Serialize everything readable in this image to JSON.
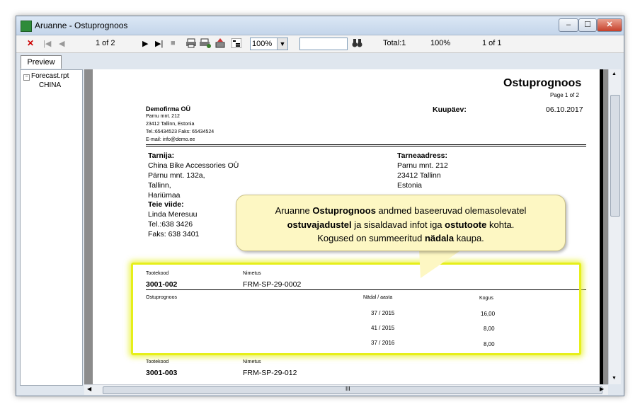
{
  "window": {
    "title": "Aruanne - Ostuprognoos",
    "minimize": "‒",
    "maximize": "☐",
    "close": "✕"
  },
  "toolbar": {
    "close_icon": "✕",
    "first_icon": "|◀",
    "prev_icon": "◀",
    "page_of": "1 of 2",
    "next_icon": "▶",
    "last_icon": "▶|",
    "stop_icon": "■",
    "zoom": "100%",
    "total": "Total:1",
    "percent": "100%",
    "of": "1 of 1"
  },
  "tabs": {
    "preview": "Preview"
  },
  "tree": {
    "root": "Forecast.rpt",
    "child": "CHINA"
  },
  "report": {
    "title": "Ostuprognoos",
    "page": "Page 1 of 2",
    "company": "Demofirma OÜ",
    "addr1": "Parnu mnt. 212",
    "addr2": "23412 Tallinn, Estonia",
    "phone": "Tel.:65434523    Faks: 65434524",
    "email": "E-mail: info@demo.ee",
    "date_label": "Kuupäev:",
    "date": "06.10.2017",
    "supplier_label": "Tarnija:",
    "supplier": [
      "China Bike Accessories OÜ",
      "Pärnu mnt. 132a,",
      "Tallinn,",
      "Hariümaa"
    ],
    "ref_label": "Teie viide:",
    "ref": [
      "Linda Meresuu",
      "Tel.:638 3426",
      "Faks: 638 3401"
    ],
    "delivery_label": "Tarneaadress:",
    "delivery": [
      "Parnu mnt. 212",
      "23412 Tallinn",
      "Estonia"
    ],
    "code_label": "Tootekood",
    "name_label": "Nimetus",
    "forecast_label": "Ostuprognoos",
    "week_label": "Nädal / aasta",
    "qty_label": "Kogus",
    "products": [
      {
        "code": "3001-002",
        "name": "FRM-SP-29-0002",
        "rows": [
          {
            "week": "37 / 2015",
            "qty": "16,00"
          },
          {
            "week": "41 / 2015",
            "qty": "8,00"
          },
          {
            "week": "37 / 2016",
            "qty": "8,00"
          }
        ]
      },
      {
        "code": "3001-003",
        "name": "FRM-SP-29-012"
      }
    ]
  },
  "callout": {
    "p1": "Aruanne ",
    "p1b": "Ostuprognoos",
    "p2": " andmed baseeruvad olemasolevatel",
    "p3b": "ostuvajadustel",
    "p4": " ja sisaldavad infot iga ",
    "p4b": "ostutoote",
    "p5": " kohta.",
    "p6": "Kogused on summeeritud ",
    "p6b": "nädala",
    "p7": " kaupa."
  },
  "scroll": {
    "h_center": "III"
  }
}
